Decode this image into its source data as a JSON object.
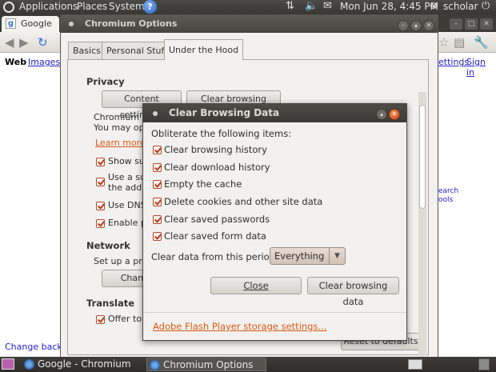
{
  "top_panel": {
    "menus": [
      "Applications",
      "Places",
      "System"
    ],
    "help_glyph": "?",
    "datetime": "Mon Jun 28,  4:45 PM",
    "user": "scholar"
  },
  "browser": {
    "tab_title": "Google",
    "g_glyph": "g",
    "nav_links": {
      "web": "Web",
      "images": "Images"
    },
    "right_links": {
      "settings": "ettings",
      "separator": "|",
      "sign_in": "Sign in"
    },
    "side_text": {
      "search": "earch",
      "tools": "ools"
    },
    "bottom_link": "Change backgr"
  },
  "options_window": {
    "title": "Chromium Options",
    "tabs": [
      {
        "label": "Basics"
      },
      {
        "label": "Personal Stuff"
      },
      {
        "label": "Under the Hood"
      }
    ],
    "privacy": {
      "heading": "Privacy",
      "content_settings_button": "Content settings...",
      "clear_browsing_data_button": "Clear browsing data...",
      "desc_line1": "Chromium m",
      "desc_line2": "You may opt",
      "learn_more": "Learn more",
      "checkboxes": [
        {
          "label": "Show sug"
        },
        {
          "label": "Use a sug"
        },
        {
          "label": "the addre"
        },
        {
          "label": "Use DNS"
        },
        {
          "label": "Enable pl"
        }
      ]
    },
    "network": {
      "heading": "Network",
      "desc": "Set up a prox",
      "change_button": "Change p"
    },
    "translate": {
      "heading": "Translate",
      "offer_label": "Offer to t"
    },
    "reset_button": "Reset to defaults"
  },
  "dialog": {
    "title": "Clear Browsing Data",
    "intro": "Obliterate the following items:",
    "items": [
      {
        "label": "Clear browsing history",
        "checked": true
      },
      {
        "label": "Clear download history",
        "checked": true
      },
      {
        "label": "Empty the cache",
        "checked": true
      },
      {
        "label": "Delete cookies and other site data",
        "checked": true
      },
      {
        "label": "Clear saved passwords",
        "checked": true
      },
      {
        "label": "Clear saved form data",
        "checked": true
      }
    ],
    "period_label": "Clear data from this period:",
    "period_value": "Everything",
    "close_button": "Close",
    "clear_button": "Clear browsing data",
    "flash_link": "Adobe Flash Player storage settings..."
  },
  "taskbar": {
    "tasks": [
      {
        "label": "Google - Chromium"
      },
      {
        "label": "Chromium Options"
      }
    ]
  },
  "colors": {
    "accent_orange": "#d65a10",
    "checkbox_red": "#b8391a",
    "panel_dark": "#3c3b37",
    "window_bg": "#f2f1f0"
  }
}
